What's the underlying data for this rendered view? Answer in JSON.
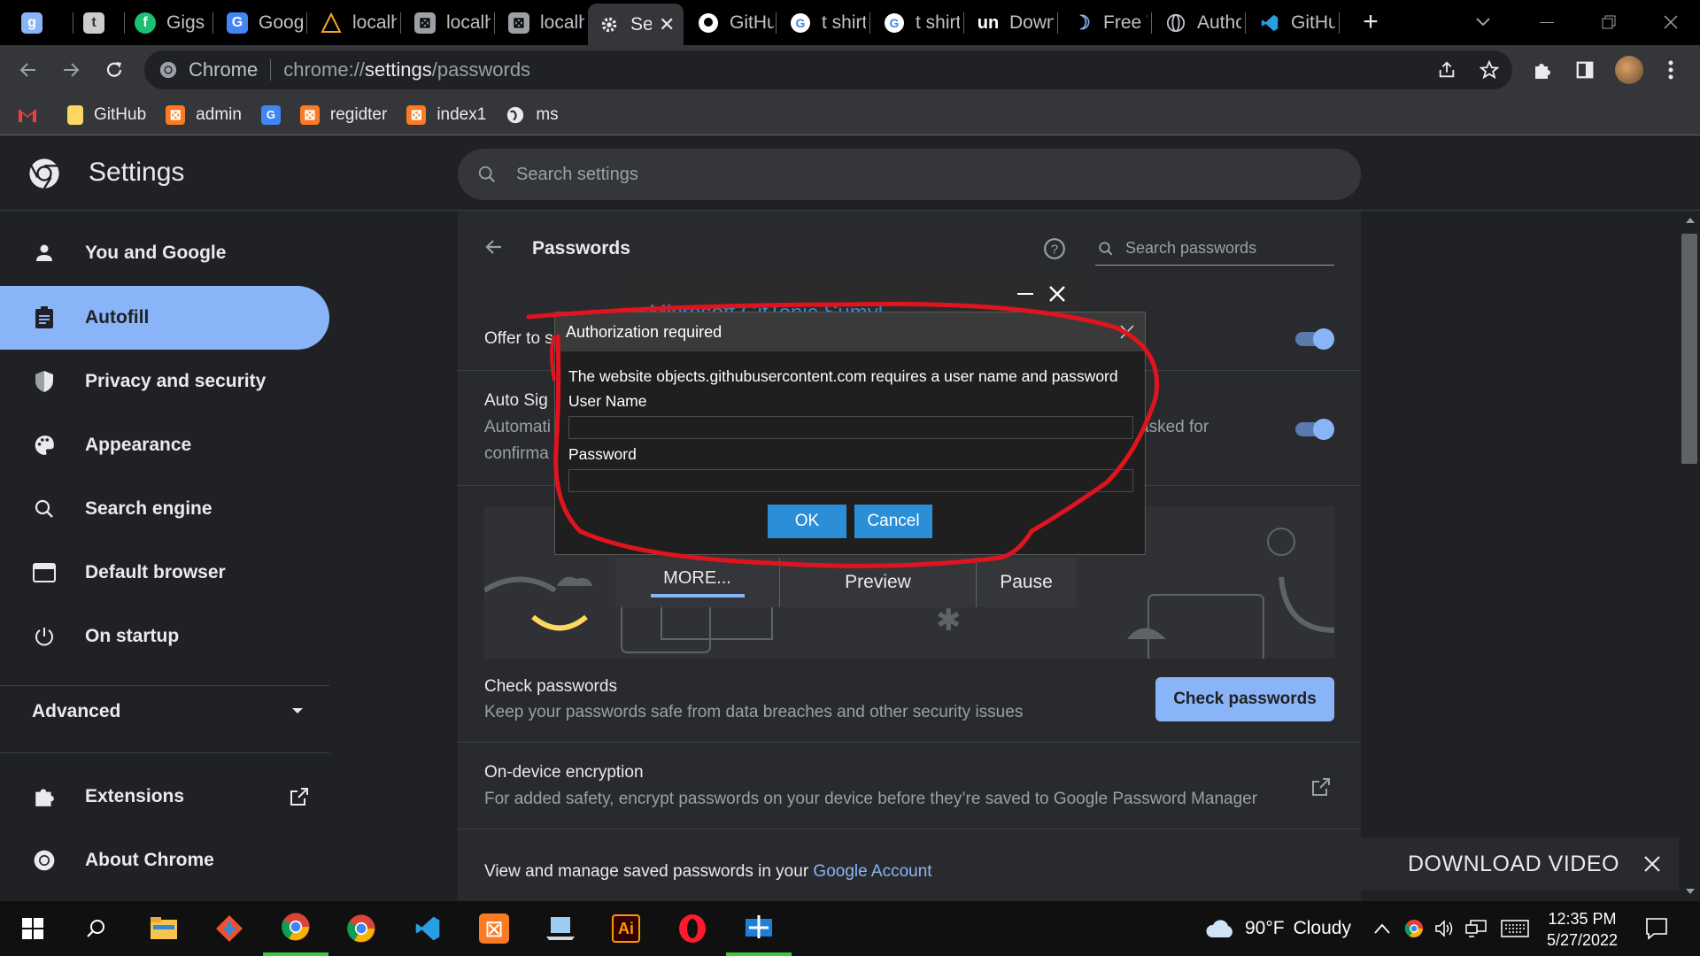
{
  "tabs": [
    {
      "title": "",
      "icon": "g-favicon"
    },
    {
      "title": "",
      "icon": "t-favicon"
    },
    {
      "title": "Gigs",
      "icon": "fiverr-favicon"
    },
    {
      "title": "Googl",
      "icon": "translate-favicon"
    },
    {
      "title": "localh",
      "icon": "xampp-warning-favicon"
    },
    {
      "title": "localh",
      "icon": "xampp-favicon"
    },
    {
      "title": "localh",
      "icon": "xampp-favicon"
    },
    {
      "title": "Se",
      "icon": "settings-favicon",
      "active": true
    },
    {
      "title": "GitHu",
      "icon": "github-favicon"
    },
    {
      "title": "t shirt",
      "icon": "google-favicon"
    },
    {
      "title": "t shirt",
      "icon": "google-favicon"
    },
    {
      "title": "Down",
      "icon": "un-favicon"
    },
    {
      "title": "Free V",
      "icon": "moon-favicon"
    },
    {
      "title": "Autho",
      "icon": "globe-favicon"
    },
    {
      "title": "GitHu",
      "icon": "vscode-favicon"
    }
  ],
  "omnibox": {
    "chip": "Chrome",
    "url_prefix": "chrome://",
    "url_bold": "settings",
    "url_suffix": "/passwords"
  },
  "bookmarks": [
    {
      "label": "",
      "icon": "gmail-icon"
    },
    {
      "label": "GitHub",
      "icon": "folder-icon"
    },
    {
      "label": "admin",
      "icon": "xampp-icon"
    },
    {
      "label": "",
      "icon": "translate-icon"
    },
    {
      "label": "regidter",
      "icon": "xampp-icon"
    },
    {
      "label": "index1",
      "icon": "xampp-icon"
    },
    {
      "label": "ms",
      "icon": "globe-icon"
    }
  ],
  "settings": {
    "title": "Settings",
    "search_placeholder": "Search settings"
  },
  "sidebar": {
    "items": [
      {
        "label": "You and Google",
        "icon": "person-icon"
      },
      {
        "label": "Autofill",
        "icon": "clipboard-icon",
        "selected": true
      },
      {
        "label": "Privacy and security",
        "icon": "shield-icon"
      },
      {
        "label": "Appearance",
        "icon": "palette-icon"
      },
      {
        "label": "Search engine",
        "icon": "search-icon"
      },
      {
        "label": "Default browser",
        "icon": "browser-icon"
      },
      {
        "label": "On startup",
        "icon": "power-icon"
      }
    ],
    "advanced": "Advanced",
    "extensions": "Extensions",
    "about": "About Chrome"
  },
  "passwords": {
    "title": "Passwords",
    "search_placeholder": "Search passwords",
    "offer_to_save": "Offer to s",
    "auto_sign_title": "Auto Sig",
    "auto_sign_desc1": "Automati",
    "auto_sign_desc2": "confirma",
    "auto_sign_tail": "asked for",
    "banner_more": "MORE...",
    "banner_preview": "Preview",
    "banner_pause": "Pause",
    "check_title": "Check passwords",
    "check_desc": "Keep your passwords safe from data breaches and other security issues",
    "check_button": "Check passwords",
    "encryption_title": "On-device encryption",
    "encryption_desc": "For added safety, encrypt passwords on your device before they’re saved to Google Password Manager",
    "manage_text": "View and manage saved passwords in your ",
    "manage_link": "Google Account"
  },
  "behind_window": {
    "title": "Microsoft GitTonic Sumyl..."
  },
  "auth_dialog": {
    "title": "Authorization required",
    "message": "The website objects.githubusercontent.com requires a user name and password",
    "username_label": "User Name",
    "username_value": "",
    "password_label": "Password",
    "password_value": "",
    "ok": "OK",
    "cancel": "Cancel"
  },
  "download_video": "DOWNLOAD VIDEO",
  "taskbar": {
    "weather_temp": "90°F",
    "weather_desc": "Cloudy",
    "time": "12:35 PM",
    "date": "5/27/2022"
  },
  "colors": {
    "accent": "#8ab4f8",
    "annotation": "#e0141e",
    "dialog_button": "#2d8ed8"
  }
}
